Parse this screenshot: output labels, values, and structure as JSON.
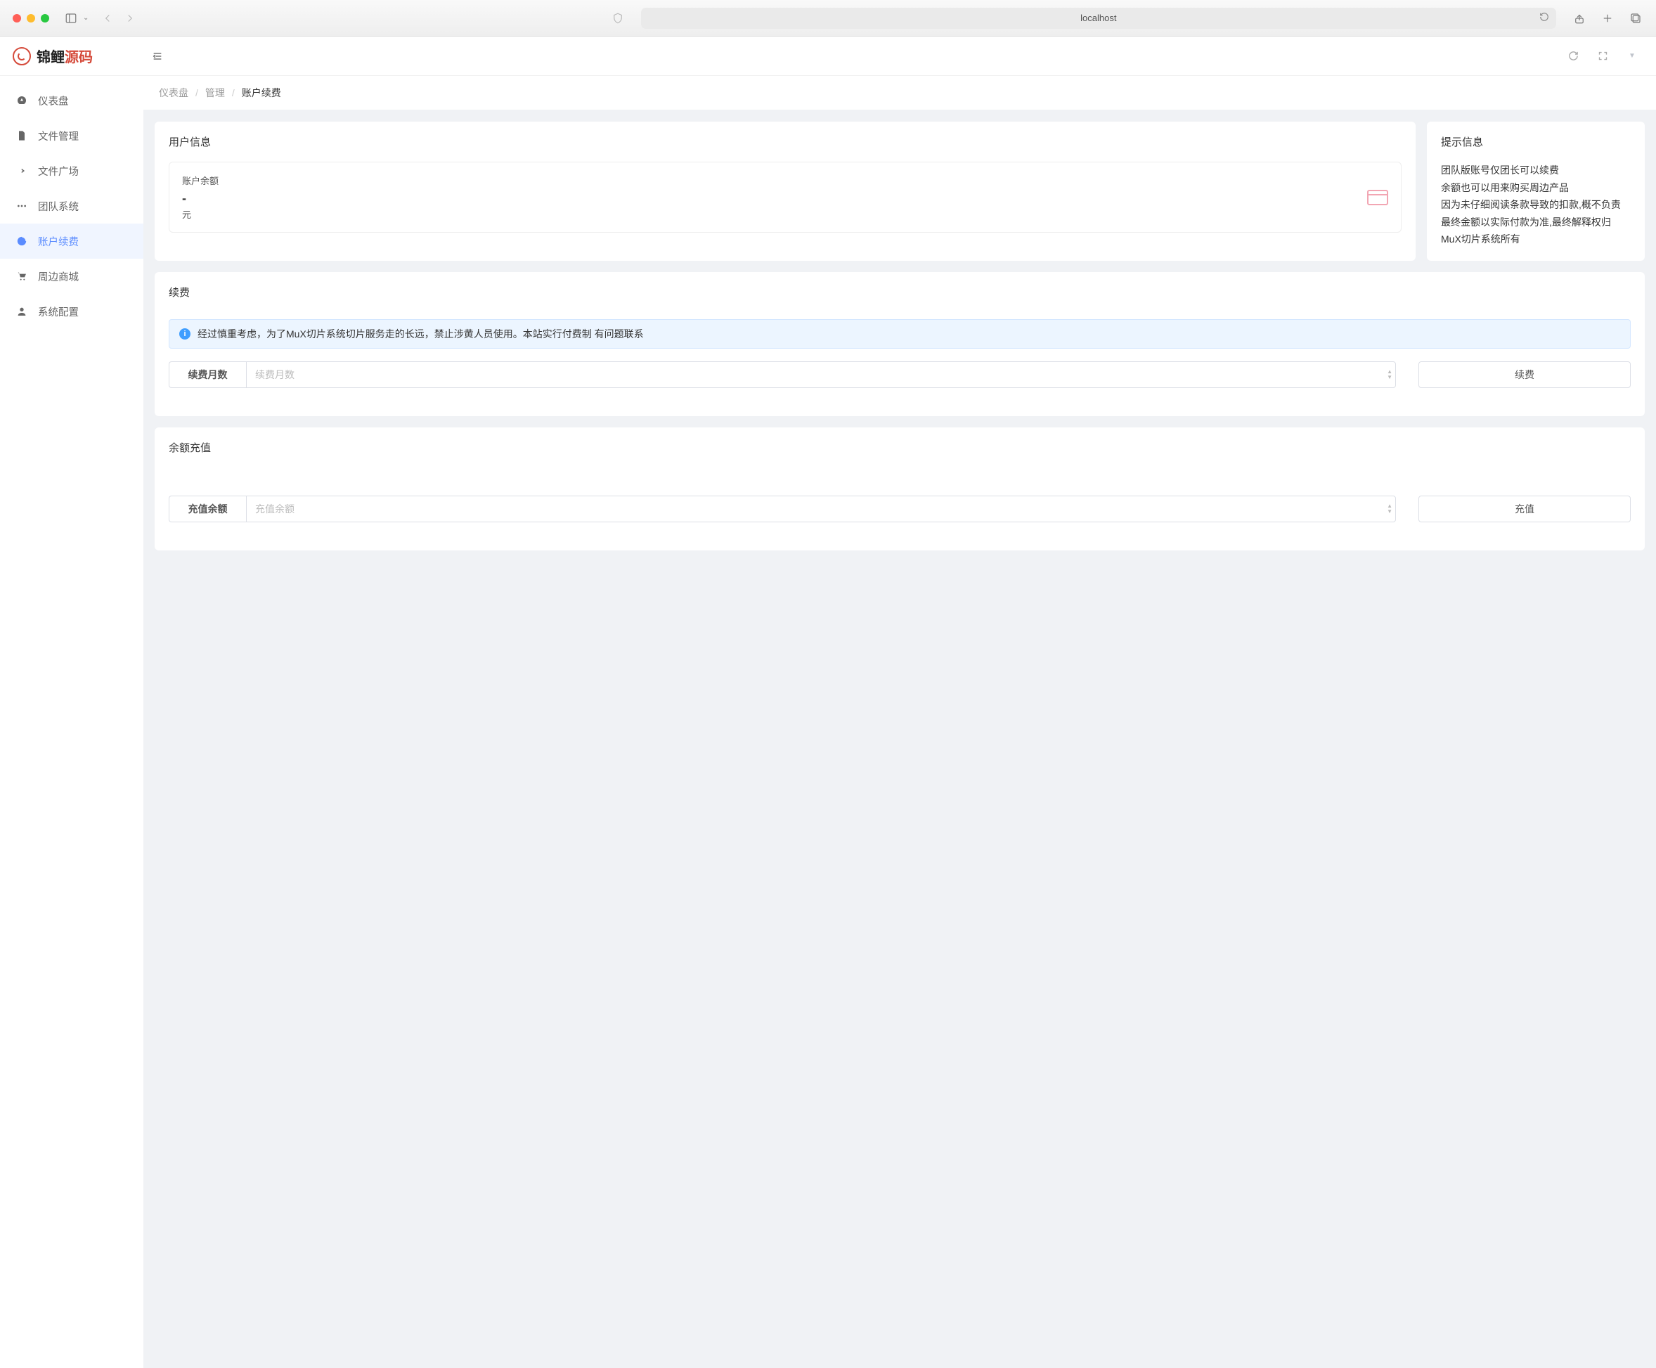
{
  "browser": {
    "url": "localhost"
  },
  "logo": {
    "part1": "锦鲤",
    "part2": "源码"
  },
  "sidebar": {
    "items": [
      {
        "label": "仪表盘"
      },
      {
        "label": "文件管理"
      },
      {
        "label": "文件广场"
      },
      {
        "label": "团队系统"
      },
      {
        "label": "账户续费"
      },
      {
        "label": "周边商城"
      },
      {
        "label": "系统配置"
      }
    ]
  },
  "breadcrumb": {
    "a": "仪表盘",
    "b": "管理",
    "c": "账户续费"
  },
  "userInfo": {
    "title": "用户信息",
    "balanceLabel": "账户余额",
    "balanceValue": "-",
    "balanceUnit": "元"
  },
  "tips": {
    "title": "提示信息",
    "lines": [
      "团队版账号仅团长可以续费",
      "余额也可以用来购买周边产品",
      "因为未仔细阅读条款导致的扣款,概不负责",
      "最终金额以实际付款为准,最终解释权归MuX切片系统所有"
    ]
  },
  "renew": {
    "title": "续费",
    "alert": "经过慎重考虑，为了MuX切片系统切片服务走的长远，禁止涉黄人员使用。本站实行付费制 有问题联系",
    "fieldLabel": "续费月数",
    "placeholder": "续费月数",
    "button": "续费"
  },
  "topup": {
    "title": "余额充值",
    "fieldLabel": "充值余额",
    "placeholder": "充值余额",
    "button": "充值"
  }
}
